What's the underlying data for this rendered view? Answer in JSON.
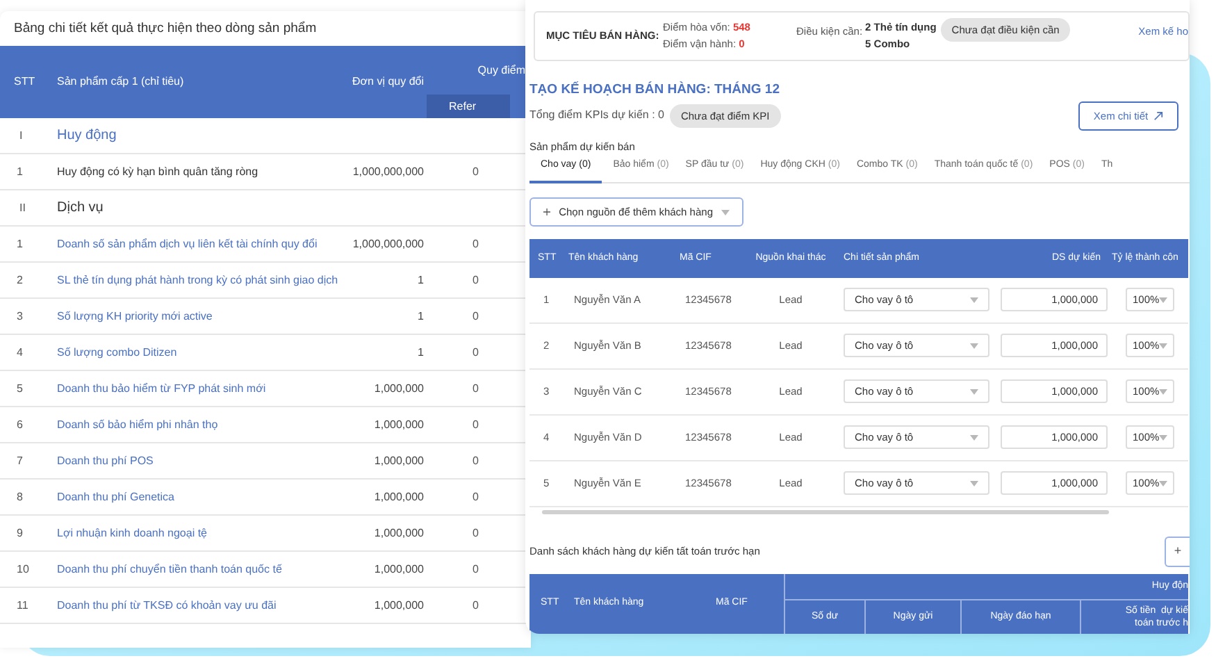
{
  "left_panel": {
    "title": "Bảng chi tiết kết quả thực hiện theo dòng sản phẩm",
    "columns": [
      "STT",
      "Sản phẩm cấp 1 (chỉ tiêu)",
      "Đơn vị quy đổi",
      "Quy điểm"
    ],
    "subcolumns": [
      "Refer"
    ],
    "rows": [
      {
        "kind": "group",
        "stt": "I",
        "name": "Huy động",
        "link": true
      },
      {
        "kind": "item",
        "stt": "1",
        "name": "Huy động có kỳ hạn bình quân tăng ròng",
        "unit": "1,000,000,000",
        "refer": "0",
        "link": false
      },
      {
        "kind": "group",
        "stt": "II",
        "name": "Dịch vụ",
        "link": false
      },
      {
        "kind": "item",
        "stt": "1",
        "name": "Doanh số sản phẩm dịch vụ liên kết tài chính quy đổi",
        "unit": "1,000,000,000",
        "refer": "0",
        "link": true
      },
      {
        "kind": "item",
        "stt": "2",
        "name": "SL thẻ tín dụng phát hành trong kỳ có phát sinh giao dịch",
        "unit": "1",
        "refer": "0",
        "link": true
      },
      {
        "kind": "item",
        "stt": "3",
        "name": "Số lượng KH priority mới active",
        "unit": "1",
        "refer": "0",
        "link": true
      },
      {
        "kind": "item",
        "stt": "4",
        "name": "Số lượng combo Ditizen",
        "unit": "1",
        "refer": "0",
        "link": true
      },
      {
        "kind": "item",
        "stt": "5",
        "name": "Doanh thu bảo hiểm từ FYP phát sinh mới",
        "unit": "1,000,000",
        "refer": "0",
        "link": true
      },
      {
        "kind": "item",
        "stt": "6",
        "name": "Doanh số bảo hiểm phi nhân thọ",
        "unit": "1,000,000",
        "refer": "0",
        "link": true
      },
      {
        "kind": "item",
        "stt": "7",
        "name": "Doanh thu phí POS",
        "unit": "1,000,000",
        "refer": "0",
        "link": true
      },
      {
        "kind": "item",
        "stt": "8",
        "name": "Doanh thu phí Genetica",
        "unit": "1,000,000",
        "refer": "0",
        "link": true
      },
      {
        "kind": "item",
        "stt": "9",
        "name": "Lợi nhuận kinh doanh ngoại tệ",
        "unit": "1,000,000",
        "refer": "0",
        "link": true
      },
      {
        "kind": "item",
        "stt": "10",
        "name": "Doanh thu phí chuyển tiền thanh toán quốc tế",
        "unit": "1,000,000",
        "refer": "0",
        "link": true
      },
      {
        "kind": "item",
        "stt": "11",
        "name": "Doanh thu phí từ TKSĐ có khoản vay ưu đãi",
        "unit": "1,000,000",
        "refer": "0",
        "link": true
      }
    ]
  },
  "right_panel": {
    "target": {
      "label": "MỤC TIÊU BÁN HÀNG:",
      "break_even_label": "Điểm hòa vốn:",
      "break_even": "548",
      "operating_label": "Điểm vận hành:",
      "operating": "0",
      "condition_label": "Điều kiện cần:",
      "conditions": [
        "2 Thẻ tín dụng",
        "5 Combo"
      ],
      "badge": "Chưa đạt điều kiện cần",
      "link": "Xem kế ho"
    },
    "plan_title": "TẠO KẾ HOẠCH BÁN HÀNG: THÁNG 12",
    "kpi_text": "Tổng điểm KPIs dự kiến : 0",
    "kpi_badge": "Chưa đạt điểm KPI",
    "detail_button": "Xem chi tiết",
    "products_title": "Sản phẩm dự kiến bán",
    "tabs": [
      {
        "label": "Cho vay",
        "count": "(0)",
        "selected": true
      },
      {
        "label": "Bảo hiểm",
        "count": "(0)",
        "selected": false
      },
      {
        "label": "SP đầu tư",
        "count": "(0)",
        "selected": false
      },
      {
        "label": "Huy động CKH",
        "count": "(0)",
        "selected": false
      },
      {
        "label": "Combo TK",
        "count": "(0)",
        "selected": false
      },
      {
        "label": "Thanh toán quốc tế",
        "count": "(0)",
        "selected": false
      },
      {
        "label": "POS",
        "count": "(0)",
        "selected": false
      },
      {
        "label": "Th",
        "selected": false
      }
    ],
    "add_source_button": "Chọn nguồn để thêm khách hàng",
    "customer_table": {
      "columns": [
        "STT",
        "Tên khách hàng",
        "Mã CIF",
        "Nguồn khai thác",
        "Chi tiết sản phẩm",
        "DS dự kiến",
        "Tỷ lệ thành côn"
      ],
      "rows": [
        {
          "stt": "1",
          "name": "Nguyễn Văn A",
          "cif": "12345678",
          "source": "Lead",
          "product": "Cho vay ô tô",
          "amount": "1,000,000",
          "rate": "100%"
        },
        {
          "stt": "2",
          "name": "Nguyễn Văn B",
          "cif": "12345678",
          "source": "Lead",
          "product": "Cho vay ô tô",
          "amount": "1,000,000",
          "rate": "100%"
        },
        {
          "stt": "3",
          "name": "Nguyễn Văn C",
          "cif": "12345678",
          "source": "Lead",
          "product": "Cho vay ô tô",
          "amount": "1,000,000",
          "rate": "100%"
        },
        {
          "stt": "4",
          "name": "Nguyễn Văn D",
          "cif": "12345678",
          "source": "Lead",
          "product": "Cho vay ô tô",
          "amount": "1,000,000",
          "rate": "100%"
        },
        {
          "stt": "5",
          "name": "Nguyễn Văn E",
          "cif": "12345678",
          "source": "Lead",
          "product": "Cho vay ô tô",
          "amount": "1,000,000",
          "rate": "100%"
        }
      ]
    },
    "early_title": "Danh sách khách hàng dự kiến tất toán trước hạn",
    "early_add_button": "+",
    "early_table": {
      "columns": [
        "STT",
        "Tên khách hàng",
        "Mã CIF"
      ],
      "group": "Huy độn",
      "subcolumns": [
        "Số dư",
        "Ngày gửi",
        "Ngày đáo hạn"
      ],
      "last_subcolumn": [
        "Số tiền  dự kiế",
        "toán trước h"
      ]
    }
  }
}
